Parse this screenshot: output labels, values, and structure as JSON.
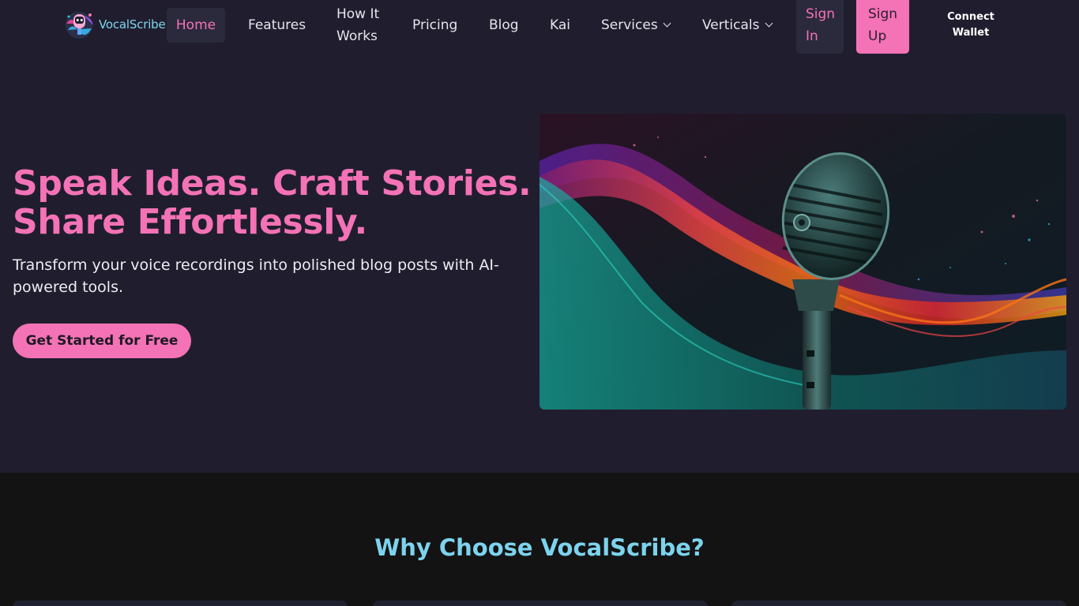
{
  "brand": {
    "name": "VocalScribe"
  },
  "nav": {
    "home": "Home",
    "features": "Features",
    "how_it_works_line1": "How It",
    "how_it_works_line2": "Works",
    "pricing": "Pricing",
    "blog": "Blog",
    "kai": "Kai",
    "services": "Services",
    "verticals": "Verticals",
    "sign_in_line1": "Sign",
    "sign_in_line2": "In",
    "sign_up_line1": "Sign",
    "sign_up_line2": "Up",
    "connect_wallet_line1": "Connect",
    "connect_wallet_line2": "Wallet"
  },
  "hero": {
    "title_line1": "Speak Ideas. Craft Stories.",
    "title_line2": "Share Effortlessly.",
    "subtitle": "Transform your voice recordings into polished blog posts with AI-powered tools.",
    "cta": "Get Started for Free"
  },
  "why": {
    "title": "Why Choose VocalScribe?"
  },
  "colors": {
    "accent_pink": "#f472b6",
    "accent_cyan": "#7dd3ee",
    "background": "#201e2e",
    "section_dark": "#131313"
  },
  "icons": [
    "logo-mascot-icon",
    "chevron-down-icon"
  ]
}
